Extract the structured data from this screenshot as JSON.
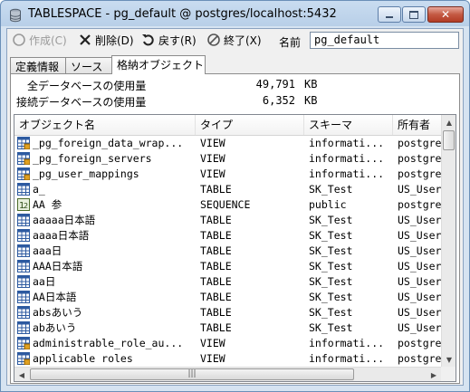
{
  "window": {
    "title": "TABLESPACE - pg_default @ postgres/localhost:5432"
  },
  "toolbar": {
    "create_label": "作成(C)",
    "delete_label": "削除(D)",
    "back_label": "戻す(R)",
    "exit_label": "終了(X)",
    "name_label": "名前",
    "name_value": "pg_default"
  },
  "tabs": [
    {
      "label": "定義情報"
    },
    {
      "label": "ソース"
    },
    {
      "label": "格納オブジェクト"
    }
  ],
  "usage": {
    "total_label": "全データベースの使用量",
    "total_value": "49,791",
    "total_unit": "KB",
    "current_label": "接続データベースの使用量",
    "current_value": "6,352",
    "current_unit": "KB"
  },
  "table": {
    "columns": [
      "オブジェクト名",
      "タイプ",
      "スキーマ",
      "所有者"
    ],
    "rows": [
      {
        "name": "_pg_foreign_data_wrap...",
        "type": "VIEW",
        "schema": "informati...",
        "owner": "postgres",
        "icon": "view-icon"
      },
      {
        "name": "_pg_foreign_servers",
        "type": "VIEW",
        "schema": "informati...",
        "owner": "postgres",
        "icon": "view-icon"
      },
      {
        "name": "_pg_user_mappings",
        "type": "VIEW",
        "schema": "informati...",
        "owner": "postgres",
        "icon": "view-icon"
      },
      {
        "name": "a_",
        "type": "TABLE",
        "schema": "SK_Test",
        "owner": "US_User",
        "icon": "table-icon"
      },
      {
        "name": "AA 参",
        "type": "SEQUENCE",
        "schema": "public",
        "owner": "postgres",
        "icon": "sequence-icon"
      },
      {
        "name": "aaaaa日本語",
        "type": "TABLE",
        "schema": "SK_Test",
        "owner": "US_User",
        "icon": "table-icon"
      },
      {
        "name": "aaaa日本語",
        "type": "TABLE",
        "schema": "SK_Test",
        "owner": "US_User",
        "icon": "table-icon"
      },
      {
        "name": "aaa日",
        "type": "TABLE",
        "schema": "SK_Test",
        "owner": "US_User",
        "icon": "table-icon"
      },
      {
        "name": "AAA日本語",
        "type": "TABLE",
        "schema": "SK_Test",
        "owner": "US_User",
        "icon": "table-icon"
      },
      {
        "name": "aa日",
        "type": "TABLE",
        "schema": "SK_Test",
        "owner": "US_User",
        "icon": "table-icon"
      },
      {
        "name": "AA日本語",
        "type": "TABLE",
        "schema": "SK_Test",
        "owner": "US_User",
        "icon": "table-icon"
      },
      {
        "name": "absあいう",
        "type": "TABLE",
        "schema": "SK_Test",
        "owner": "US_User",
        "icon": "table-icon"
      },
      {
        "name": "abあいう",
        "type": "TABLE",
        "schema": "SK_Test",
        "owner": "US_User",
        "icon": "table-icon"
      },
      {
        "name": "administrable_role_au...",
        "type": "VIEW",
        "schema": "informati...",
        "owner": "postgres",
        "icon": "view-icon"
      },
      {
        "name": "applicable roles",
        "type": "VIEW",
        "schema": "informati...",
        "owner": "postgres",
        "icon": "view-icon"
      }
    ]
  },
  "colors": {
    "title_bar": "#c9dcf0",
    "close_button": "#c45a43",
    "table_header": "#f2f2f2"
  }
}
